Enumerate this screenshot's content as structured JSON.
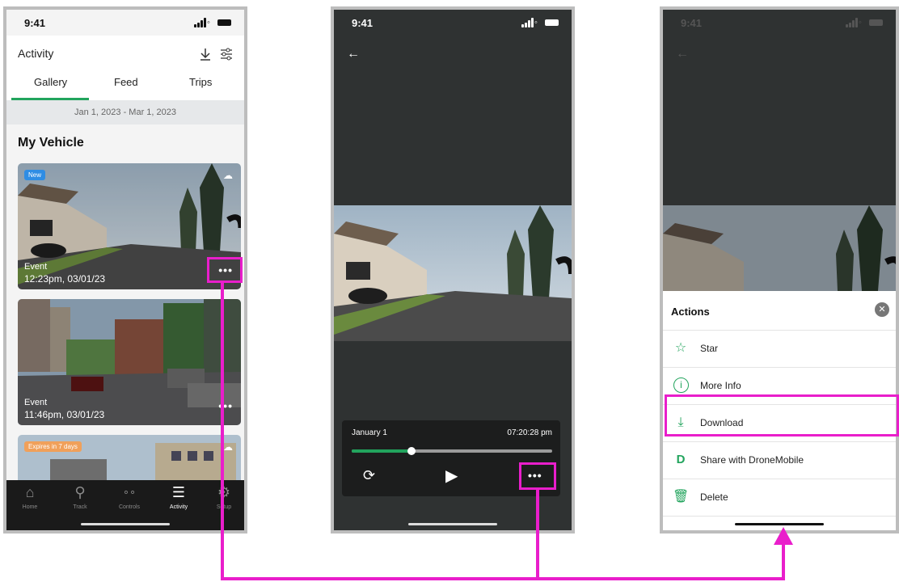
{
  "status": {
    "time": "9:41"
  },
  "phone1": {
    "header": {
      "title": "Activity"
    },
    "tabs": [
      {
        "label": "Gallery"
      },
      {
        "label": "Feed"
      },
      {
        "label": "Trips"
      }
    ],
    "date_range": "Jan 1, 2023 - Mar 1, 2023",
    "section_title": "My Vehicle",
    "cards": [
      {
        "badge": "New",
        "type": "Event",
        "time": "12:23pm, 03/01/23"
      },
      {
        "type": "Event",
        "time": "11:46pm, 03/01/23"
      },
      {
        "badge": "Expires in 7 days"
      }
    ],
    "nav": [
      {
        "label": "Home",
        "icon": "home-icon"
      },
      {
        "label": "Track",
        "icon": "location-pin-icon"
      },
      {
        "label": "Controls",
        "icon": "controls-icon"
      },
      {
        "label": "Activity",
        "icon": "list-icon"
      },
      {
        "label": "Setup",
        "icon": "gear-icon"
      }
    ]
  },
  "phone2": {
    "player": {
      "date": "January 1",
      "time": "07:20:28 pm",
      "progress": 0.3
    }
  },
  "phone3": {
    "sheet": {
      "title": "Actions",
      "items": [
        {
          "label": "Star",
          "icon": "star-icon"
        },
        {
          "label": "More Info",
          "icon": "info-icon"
        },
        {
          "label": "Download",
          "icon": "download-icon"
        },
        {
          "label": "Share with DroneMobile",
          "icon": "dronemobile-logo-icon"
        },
        {
          "label": "Delete",
          "icon": "trash-icon"
        }
      ]
    }
  },
  "colors": {
    "accent": "#22a45d",
    "highlight": "#e91ecb",
    "badge_new": "#2f8de4",
    "badge_expire": "#f0a05a"
  }
}
